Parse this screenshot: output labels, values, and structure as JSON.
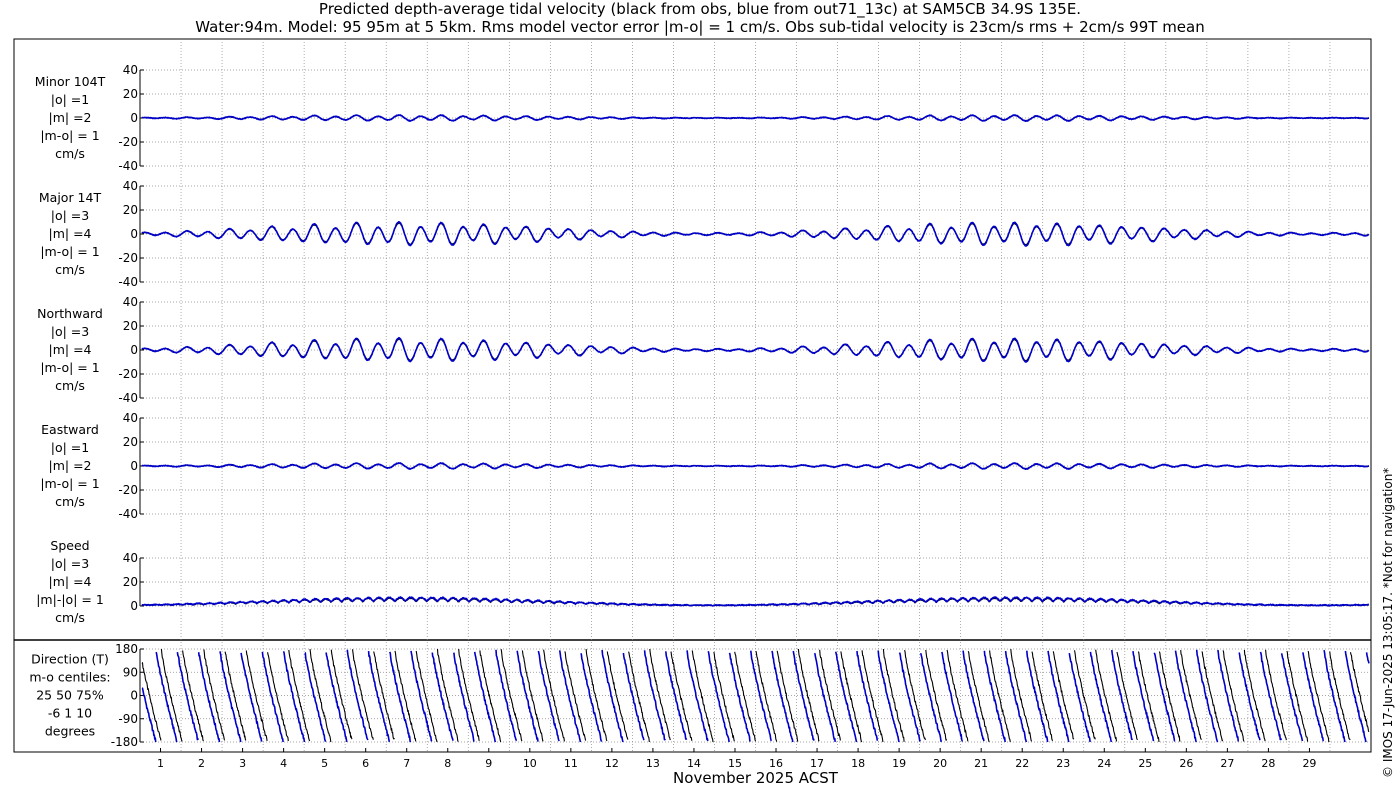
{
  "title_line1": "Predicted depth-average tidal velocity (black from obs, blue from out71_13c) at SAM5CB 34.9S 135E.",
  "title_line2": "Water:94m. Model: 95 95m at 5 5km. Rms model vector error |m-o| = 1 cm/s. Obs sub-tidal velocity is 23cm/s rms + 2cm/s 99T mean",
  "copyright": "© IMOS 17-Jun-2025 13:05:17. *Not for navigation*",
  "colors": {
    "obs": "#000000",
    "model": "#0000c8",
    "grid": "#8a8a8a"
  },
  "chart_data": {
    "type": "line",
    "xlabel": "November 2025 ACST",
    "x_ticks": [
      "1",
      "2",
      "3",
      "4",
      "5",
      "6",
      "7",
      "8",
      "9",
      "10",
      "11",
      "12",
      "13",
      "14",
      "15",
      "16",
      "17",
      "18",
      "19",
      "20",
      "21",
      "22",
      "23",
      "24",
      "25",
      "26",
      "27",
      "28",
      "29"
    ],
    "xlim": [
      0,
      30
    ],
    "grid": true,
    "series": [
      {
        "name": "Obs",
        "color": "#000000"
      },
      {
        "name": "Model",
        "color": "#0000c8"
      }
    ],
    "panels": [
      {
        "id": "minor",
        "label_lines": [
          "Minor 104T",
          "|o| =1",
          "|m| =2",
          "|m-o| = 1",
          "cm/s"
        ],
        "ylim": [
          -40,
          40
        ],
        "yticks": [
          "40",
          "20",
          "0",
          "-20",
          "-40"
        ],
        "amplitude": 2
      },
      {
        "id": "major",
        "label_lines": [
          "Major 14T",
          "|o| =3",
          "|m| =4",
          "|m-o| = 1",
          "cm/s"
        ],
        "ylim": [
          -40,
          40
        ],
        "yticks": [
          "40",
          "20",
          "0",
          "-20",
          "-40"
        ],
        "amplitude": 8
      },
      {
        "id": "north",
        "label_lines": [
          "Northward",
          "|o| =3",
          "|m| =4",
          "|m-o| = 1",
          "cm/s"
        ],
        "ylim": [
          -40,
          40
        ],
        "yticks": [
          "40",
          "20",
          "0",
          "-20",
          "-40"
        ],
        "amplitude": 8
      },
      {
        "id": "east",
        "label_lines": [
          "Eastward",
          "|o| =1",
          "|m| =2",
          "|m-o| = 1",
          "cm/s"
        ],
        "ylim": [
          -40,
          40
        ],
        "yticks": [
          "40",
          "20",
          "0",
          "-20",
          "-40"
        ],
        "amplitude": 2
      },
      {
        "id": "speed",
        "label_lines": [
          "Speed",
          "|o| =3",
          "|m| =4",
          "|m|-|o| = 1",
          "cm/s"
        ],
        "ylim": [
          0,
          40
        ],
        "yticks": [
          "40",
          "20",
          "0"
        ],
        "amplitude": 8
      },
      {
        "id": "direction",
        "label_lines": [
          "Direction (T)",
          "m-o centiles:",
          "25  50  75%",
          "-6   1  10",
          "degrees"
        ],
        "ylim": [
          -180,
          180
        ],
        "yticks": [
          "180",
          "90",
          "0",
          "-90",
          "-180"
        ],
        "amplitude": 180
      }
    ]
  }
}
